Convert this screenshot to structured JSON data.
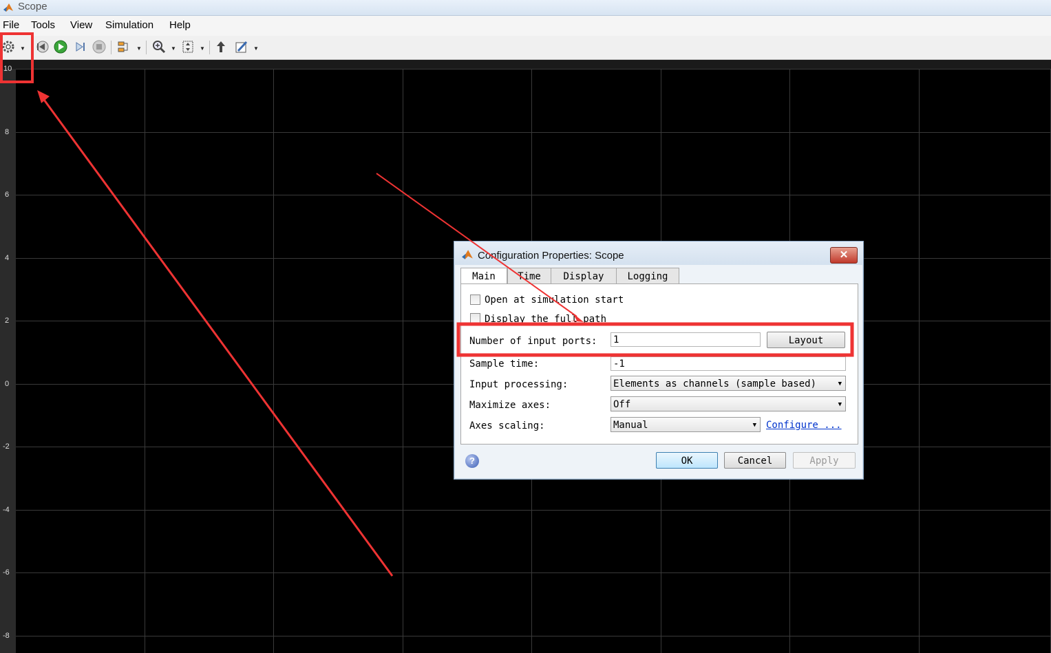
{
  "window": {
    "title": "Scope"
  },
  "menu": [
    "File",
    "Tools",
    "View",
    "Simulation",
    "Help"
  ],
  "toolbar": {
    "icons": [
      "gear-icon",
      "step-back-icon",
      "run-icon",
      "step-forward-icon",
      "stop-icon",
      "signal-select-icon",
      "zoom-in-icon",
      "fit-scale-icon",
      "highlight-block-icon",
      "edit-style-icon"
    ]
  },
  "plot": {
    "y_ticks": [
      "10",
      "8",
      "6",
      "4",
      "2",
      "0",
      "-2",
      "-4",
      "-6",
      "-8"
    ],
    "background": "#000000",
    "grid_color": "#3a3a3a"
  },
  "dialog": {
    "title": "Configuration Properties: Scope",
    "close_label": "✕",
    "tabs": [
      "Main",
      "Time",
      "Display",
      "Logging"
    ],
    "active_tab": "Main",
    "open_at_start_label": "Open at simulation start",
    "display_full_path_label": "Display the full path",
    "num_ports_label": "Number of input ports:",
    "num_ports_value": "1",
    "layout_label": "Layout",
    "sample_time_label": "Sample time:",
    "sample_time_value": "-1",
    "input_processing_label": "Input processing:",
    "input_processing_value": "Elements as channels (sample based)",
    "maximize_axes_label": "Maximize axes:",
    "maximize_axes_value": "Off",
    "axes_scaling_label": "Axes scaling:",
    "axes_scaling_value": "Manual",
    "configure_label": "Configure ...",
    "ok_label": "OK",
    "cancel_label": "Cancel",
    "apply_label": "Apply",
    "help_label": "?"
  },
  "annotation_color": "#ee3333"
}
